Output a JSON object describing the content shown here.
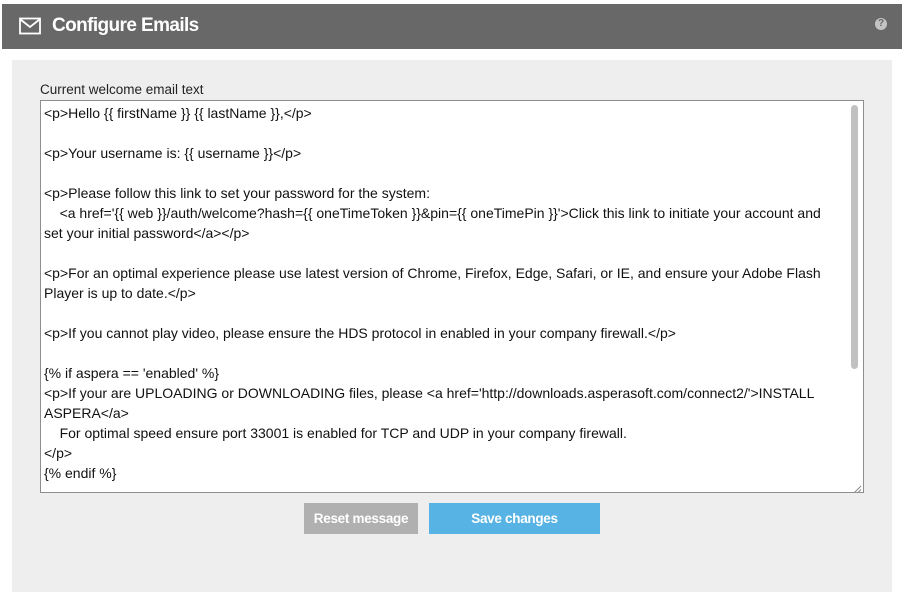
{
  "header": {
    "title": "Configure Emails",
    "icon": "mail-icon",
    "help_icon": "help-icon",
    "help_glyph": "?"
  },
  "form": {
    "label": "Current welcome email text",
    "value": "<p>Hello {{ firstName }} {{ lastName }},</p>\n\n<p>Your username is: {{ username }}</p>\n\n<p>Please follow this link to set your password for the system:\n    <a href='{{ web }}/auth/welcome?hash={{ oneTimeToken }}&pin={{ oneTimePin }}'>Click this link to initiate your account and set your initial password</a></p>\n\n<p>For an optimal experience please use latest version of Chrome, Firefox, Edge, Safari, or IE, and ensure your Adobe Flash Player is up to date.</p>\n\n<p>If you cannot play video, please ensure the HDS protocol in enabled in your company firewall.</p>\n\n{% if aspera == 'enabled' %}\n<p>If your are UPLOADING or DOWNLOADING files, please <a href='http://downloads.asperasoft.com/connect2/'>INSTALL ASPERA</a>\n    For optimal speed ensure port 33001 is enabled for TCP and UDP in your company firewall.\n</p>\n{% endif %}"
  },
  "buttons": {
    "reset_label": "Reset message",
    "save_label": "Save changes"
  },
  "colors": {
    "header_bg": "#686868",
    "panel_bg": "#eeeeee",
    "reset_bg": "#b0b0b0",
    "save_bg": "#57b3e3"
  }
}
